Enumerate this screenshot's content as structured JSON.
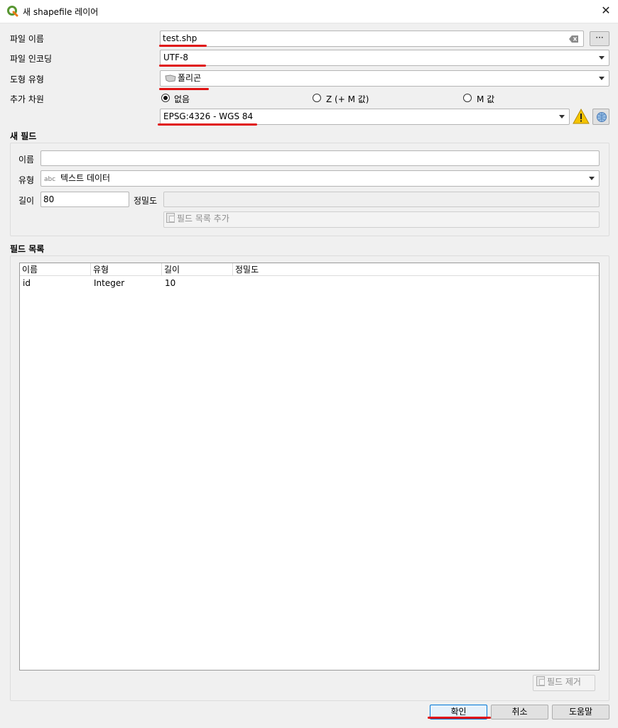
{
  "window": {
    "title": "새 shapefile 레이어",
    "close_glyph": "✕"
  },
  "form": {
    "file_name_label": "파일 이름",
    "file_name_value": "test.shp",
    "browse_label": "···",
    "encoding_label": "파일 인코딩",
    "encoding_value": "UTF-8",
    "geometry_label": "도형 유형",
    "geometry_value": "폴리곤",
    "dimensions_label": "추가 차원",
    "dim_options": [
      "없음",
      "Z (+ M 값)",
      "M 값"
    ],
    "dim_selected": "없음",
    "crs_value": "EPSG:4326 - WGS 84"
  },
  "new_field": {
    "section_title": "새 필드",
    "name_label": "이름",
    "name_value": "",
    "type_label": "유형",
    "type_prefix": "abc",
    "type_value": "텍스트 데이터",
    "length_label": "길이",
    "length_value": "80",
    "precision_label": "정밀도",
    "precision_value": "",
    "add_button": "필드 목록 추가"
  },
  "field_list": {
    "section_title": "필드 목록",
    "columns": [
      "이름",
      "유형",
      "길이",
      "정밀도"
    ],
    "rows": [
      [
        "id",
        "Integer",
        "10",
        ""
      ]
    ],
    "remove_button": "필드 제거"
  },
  "buttons": {
    "ok": "확인",
    "cancel": "취소",
    "help": "도움말"
  },
  "colors": {
    "annotation_red": "#e01212",
    "warning_yellow": "#f5c400"
  }
}
